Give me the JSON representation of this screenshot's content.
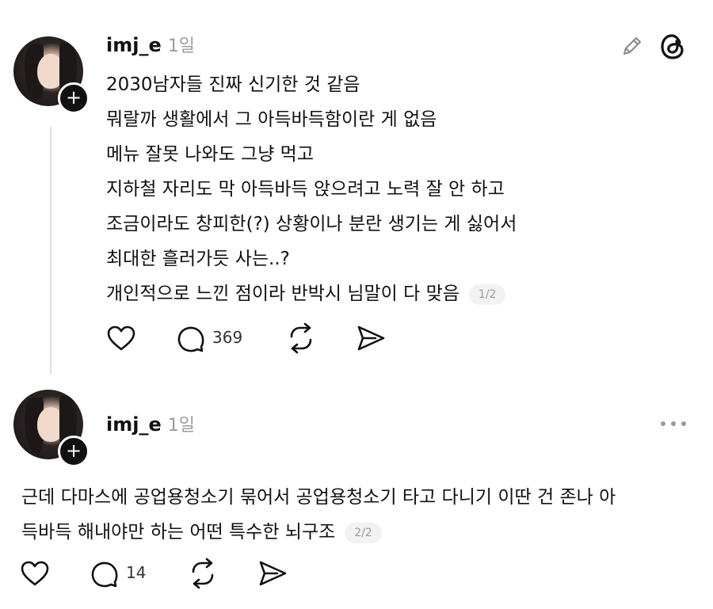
{
  "post1": {
    "username": "imj_e",
    "time": "1일",
    "lines": [
      "2030남자들 진짜 신기한 것 같음",
      "뭐랄까 생활에서 그 아득바득함이란 게 없음",
      "메뉴 잘못 나와도 그냥 먹고",
      "지하철 자리도 막 아득바득 앉으려고 노력 잘 안 하고",
      "조금이라도 창피한(?) 상황이나 분란 생기는 게 싫어서",
      "최대한 흘러가듯 사는..?",
      "개인적으로 느낀 점이라 반박시 님말이 다 맞음"
    ],
    "page": "1/2",
    "reply_count": "369",
    "icons": [
      "edit-icon",
      "threads-logo-icon",
      "heart-icon",
      "comment-icon",
      "repost-icon",
      "share-icon"
    ]
  },
  "post2": {
    "username": "imj_e",
    "time": "1일",
    "lines": [
      "근데 다마스에 공업용청소기 묶어서 공업용청소기 타고 다니기 이딴 건 존나 아",
      "득바득 해내야만 하는 어떤 특수한 뇌구조"
    ],
    "page": "2/2",
    "reply_count": "14",
    "icons": [
      "more-icon",
      "heart-icon",
      "comment-icon",
      "repost-icon",
      "share-icon"
    ]
  }
}
